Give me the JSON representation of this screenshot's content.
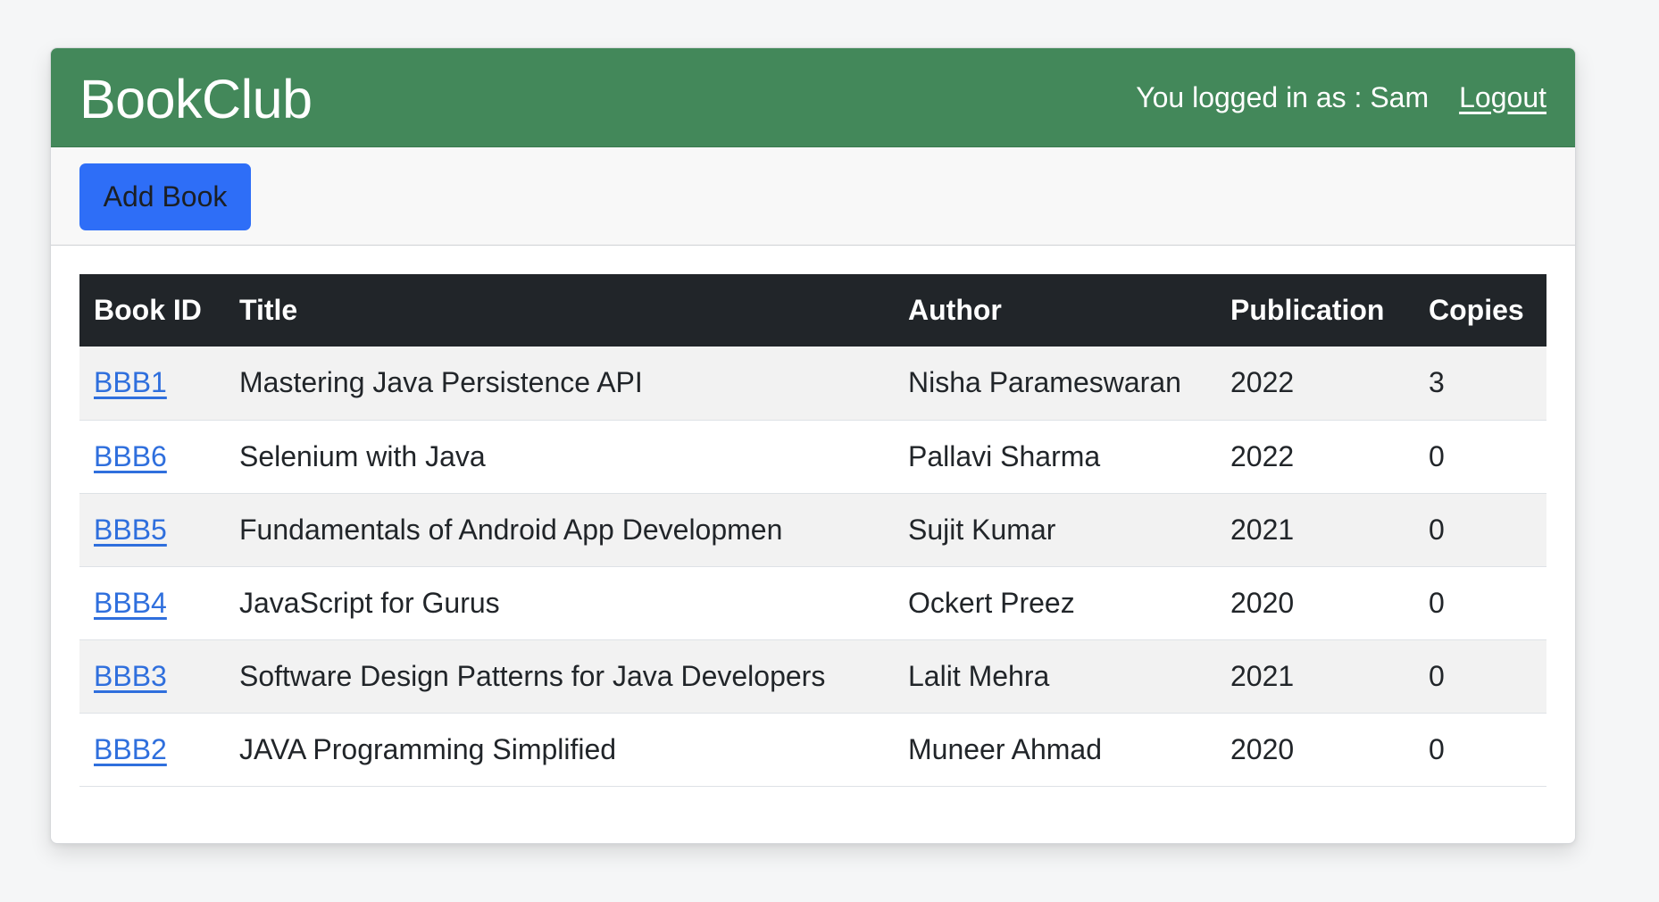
{
  "header": {
    "brand": "BookClub",
    "logged_in_text": "You logged in as : Sam",
    "logout_label": "Logout"
  },
  "toolbar": {
    "add_book_label": "Add Book"
  },
  "table": {
    "columns": [
      "Book ID",
      "Title",
      "Author",
      "Publication",
      "Copies"
    ],
    "rows": [
      {
        "id": "BBB1",
        "title": "Mastering Java Persistence API",
        "author": "Nisha Parameswaran",
        "publication": "2022",
        "copies": "3"
      },
      {
        "id": "BBB6",
        "title": "Selenium with Java",
        "author": "Pallavi Sharma",
        "publication": "2022",
        "copies": "0"
      },
      {
        "id": "BBB5",
        "title": "Fundamentals of Android App Developmen",
        "author": "Sujit Kumar",
        "publication": "2021",
        "copies": "0"
      },
      {
        "id": "BBB4",
        "title": "JavaScript for Gurus",
        "author": "Ockert Preez",
        "publication": "2020",
        "copies": "0"
      },
      {
        "id": "BBB3",
        "title": "Software Design Patterns for Java Developers",
        "author": "Lalit Mehra",
        "publication": "2021",
        "copies": "0"
      },
      {
        "id": "BBB2",
        "title": "JAVA Programming Simplified",
        "author": "Muneer Ahmad",
        "publication": "2020",
        "copies": "0"
      }
    ]
  },
  "colors": {
    "header_bg": "#43885a",
    "button_bg": "#2e6ef7",
    "table_head_bg": "#212529",
    "link": "#2f6fdd"
  }
}
